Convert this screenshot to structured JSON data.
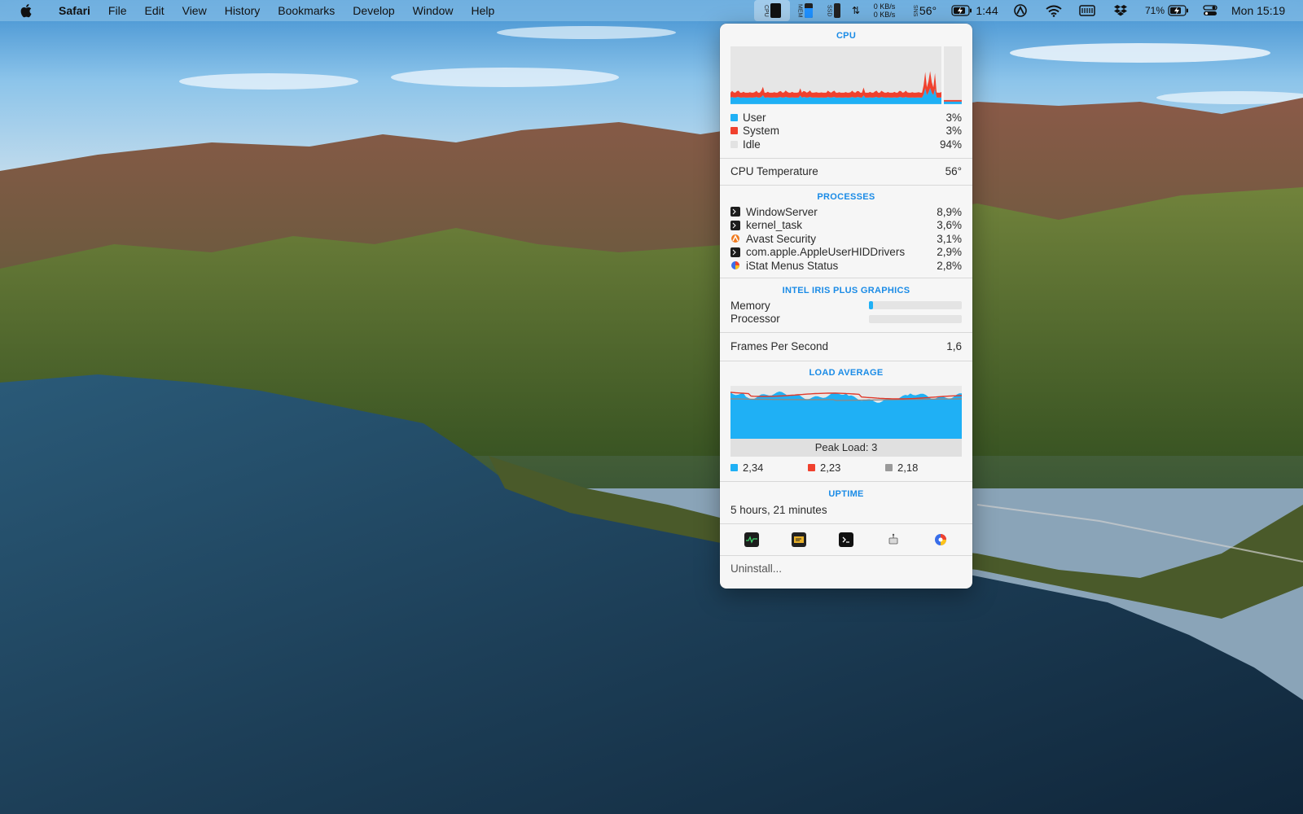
{
  "menubar": {
    "app_name": "Safari",
    "menus": [
      "File",
      "Edit",
      "View",
      "History",
      "Bookmarks",
      "Develop",
      "Window",
      "Help"
    ],
    "status": {
      "cpu_label": "CPU",
      "mem_label": "MEM",
      "ssd_label": "SSD",
      "net_up": "0 KB/s",
      "net_down": "0 KB/s",
      "sensor_label": "SNS",
      "temperature": "56°",
      "battery_time": "1:44",
      "battery_percent": "71%",
      "clock": "Mon 15:19"
    }
  },
  "popover": {
    "cpu": {
      "title": "CPU",
      "legend": [
        {
          "label": "User",
          "value": "3%",
          "color": "#1fb0f5"
        },
        {
          "label": "System",
          "value": "3%",
          "color": "#f0412e"
        },
        {
          "label": "Idle",
          "value": "94%",
          "color": "#e2e2e2"
        }
      ]
    },
    "cpu_temperature": {
      "label": "CPU Temperature",
      "value": "56°"
    },
    "processes": {
      "title": "PROCESSES",
      "items": [
        {
          "name": "WindowServer",
          "value": "8,9%",
          "icon": "terminal-icon"
        },
        {
          "name": "kernel_task",
          "value": "3,6%",
          "icon": "terminal-icon"
        },
        {
          "name": "Avast Security",
          "value": "3,1%",
          "icon": "avast-icon"
        },
        {
          "name": "com.apple.AppleUserHIDDrivers",
          "value": "2,9%",
          "icon": "terminal-icon"
        },
        {
          "name": "iStat Menus Status",
          "value": "2,8%",
          "icon": "istat-icon"
        }
      ]
    },
    "gpu": {
      "title": "INTEL IRIS PLUS GRAPHICS",
      "memory_label": "Memory",
      "memory_level": 0.04,
      "processor_label": "Processor",
      "processor_level": 0.0
    },
    "fps": {
      "label": "Frames Per Second",
      "value": "1,6"
    },
    "load_average": {
      "title": "LOAD AVERAGE",
      "peak_label": "Peak Load: 3",
      "values": [
        {
          "value": "2,34",
          "color": "#1fb0f5"
        },
        {
          "value": "2,23",
          "color": "#f0412e"
        },
        {
          "value": "2,18",
          "color": "#9a9a9a"
        }
      ]
    },
    "uptime": {
      "title": "UPTIME",
      "value": "5 hours, 21 minutes"
    },
    "footer_icons": [
      "activity-monitor-icon",
      "console-icon",
      "terminal-icon",
      "system-info-icon",
      "istat-menus-icon"
    ],
    "uninstall_label": "Uninstall..."
  }
}
